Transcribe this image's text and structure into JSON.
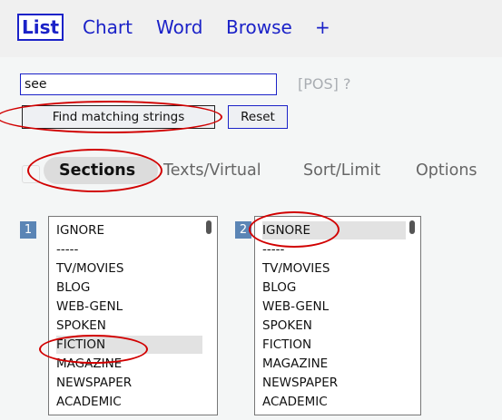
{
  "tabs": {
    "list": "List",
    "chart": "Chart",
    "word": "Word",
    "browse": "Browse",
    "add": "+"
  },
  "search": {
    "value": "see",
    "pos_hint": "[POS] ?"
  },
  "buttons": {
    "find": "Find matching strings",
    "reset": "Reset"
  },
  "subnav": {
    "sections": "Sections",
    "texts": "Texts/Virtual",
    "sort": "Sort/Limit",
    "options": "Options"
  },
  "lists": {
    "list1": {
      "number": "1",
      "options": [
        "IGNORE",
        "-----",
        "TV/MOVIES",
        "BLOG",
        "WEB-GENL",
        "SPOKEN",
        "FICTION",
        "MAGAZINE",
        "NEWSPAPER",
        "ACADEMIC"
      ],
      "selected": "FICTION"
    },
    "list2": {
      "number": "2",
      "options": [
        "IGNORE",
        "-----",
        "TV/MOVIES",
        "BLOG",
        "WEB-GENL",
        "SPOKEN",
        "FICTION",
        "MAGAZINE",
        "NEWSPAPER",
        "ACADEMIC"
      ],
      "selected": "IGNORE"
    }
  },
  "colors": {
    "link": "#1b22c8",
    "annotation": "#d10000",
    "badge": "#5b85b5"
  }
}
